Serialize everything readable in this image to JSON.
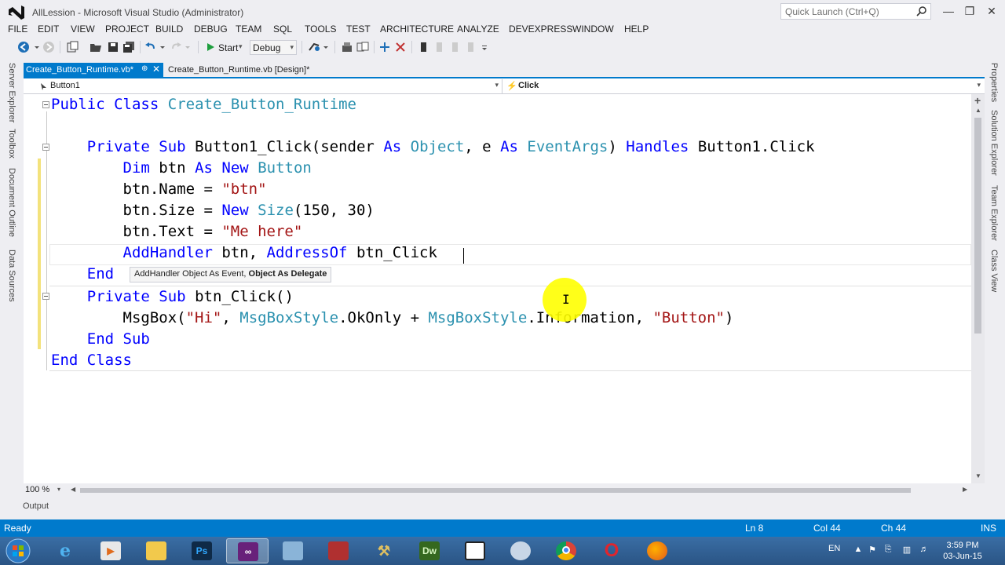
{
  "window": {
    "title": "AllLession - Microsoft Visual Studio (Administrator)",
    "quick_launch_placeholder": "Quick Launch (Ctrl+Q)"
  },
  "menu": [
    "FILE",
    "EDIT",
    "VIEW",
    "PROJECT",
    "BUILD",
    "DEBUG",
    "TEAM",
    "SQL",
    "TOOLS",
    "TEST",
    "ARCHITECTURE",
    "ANALYZE",
    "DEVEXPRESS",
    "WINDOW",
    "HELP"
  ],
  "toolbar": {
    "start_label": "Start",
    "configuration": "Debug"
  },
  "left_tool_windows": [
    "Server Explorer",
    "Toolbox",
    "Document Outline",
    "Data Sources"
  ],
  "right_tool_windows": [
    "Properties",
    "Solution Explorer",
    "Team Explorer",
    "Class View"
  ],
  "tabs": {
    "active": "Create_Button_Runtime.vb*",
    "design": "Create_Button_Runtime.vb [Design]*"
  },
  "navbar": {
    "object": "Button1",
    "event": "Click"
  },
  "code": {
    "l1": [
      "Public",
      "Class",
      "Create_Button_Runtime"
    ],
    "l3": [
      "Private",
      "Sub",
      "Button1_Click(sender",
      "As",
      "Object",
      ", e",
      "As",
      "EventArgs",
      ")",
      "Handles",
      "Button1.Click"
    ],
    "l4": [
      "Dim",
      "btn",
      "As",
      "New",
      "Button"
    ],
    "l5": [
      "btn.Name = ",
      "\"btn\""
    ],
    "l6": [
      "btn.Size = ",
      "New",
      "Size",
      "(150, 30)"
    ],
    "l7": [
      "btn.Text = ",
      "\"Me here\""
    ],
    "l8": [
      "AddHandler",
      " btn, ",
      "AddressOf",
      " btn_Click"
    ],
    "l9": [
      "End"
    ],
    "l10": [
      "Private",
      "Sub",
      "btn_Click()"
    ],
    "l11": [
      "MsgBox(",
      "\"Hi\"",
      ", ",
      "MsgBoxStyle",
      ".OkOnly + ",
      "MsgBoxStyle",
      ".Information, ",
      "\"Button\"",
      ")"
    ],
    "l12": [
      "End",
      "Sub"
    ],
    "l13": [
      "End",
      "Class"
    ]
  },
  "param_tip": {
    "prefix": "AddHandler  Object As Event, ",
    "bold": "Object As Delegate"
  },
  "zoom": "100 %",
  "output_tab": "Output",
  "status": {
    "state": "Ready",
    "line": "Ln 8",
    "col": "Col 44",
    "ch": "Ch 44",
    "mode": "INS"
  },
  "tray": {
    "lang": "EN",
    "time": "3:59 PM",
    "date": "03-Jun-15"
  },
  "colors": {
    "accent": "#007acc",
    "keyword": "#0000ff",
    "type": "#2b91af",
    "string": "#a31515"
  }
}
